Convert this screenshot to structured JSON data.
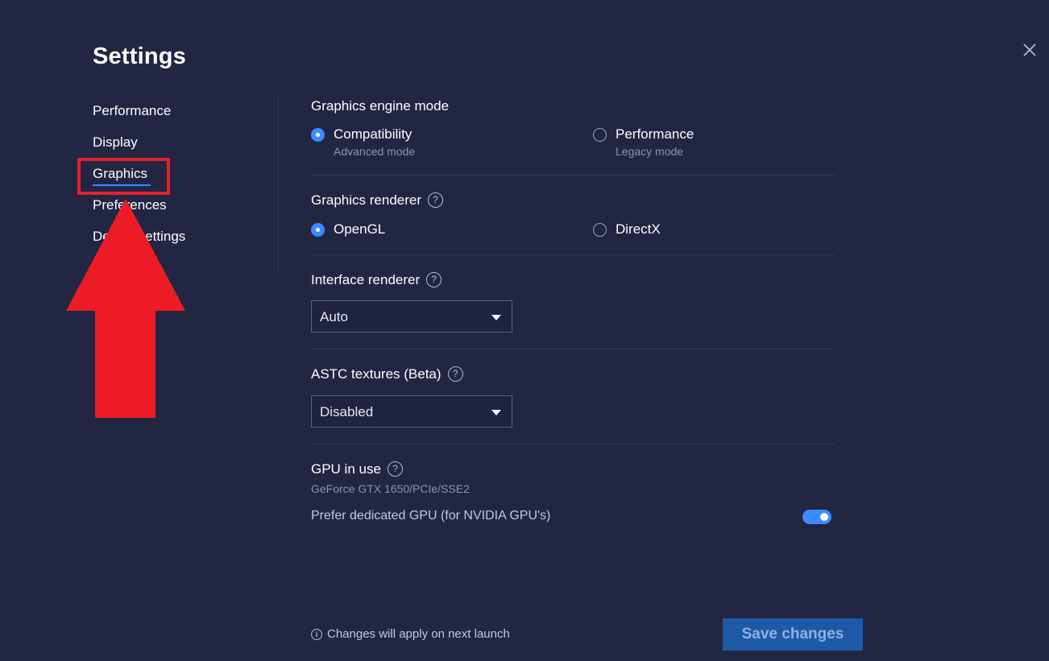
{
  "window": {
    "title": "Settings"
  },
  "nav": {
    "items": [
      {
        "label": "Performance",
        "active": false
      },
      {
        "label": "Display",
        "active": false
      },
      {
        "label": "Graphics",
        "active": true
      },
      {
        "label": "Preferences",
        "active": false
      },
      {
        "label": "Device settings",
        "active": false
      }
    ]
  },
  "graphics_engine": {
    "title": "Graphics engine mode",
    "options": [
      {
        "label": "Compatibility",
        "sub": "Advanced mode",
        "selected": true
      },
      {
        "label": "Performance",
        "sub": "Legacy mode",
        "selected": false
      }
    ]
  },
  "graphics_renderer": {
    "title": "Graphics renderer",
    "options": [
      {
        "label": "OpenGL",
        "selected": true
      },
      {
        "label": "DirectX",
        "selected": false
      }
    ]
  },
  "interface_renderer": {
    "title": "Interface renderer",
    "value": "Auto"
  },
  "astc": {
    "title": "ASTC textures (Beta)",
    "value": "Disabled"
  },
  "gpu": {
    "title": "GPU in use",
    "name": "GeForce GTX 1650/PCIe/SSE2",
    "prefer_label": "Prefer dedicated GPU (for NVIDIA GPU's)",
    "prefer_enabled": true
  },
  "footer": {
    "note": "Changes will apply on next launch",
    "save_label": "Save changes"
  },
  "colors": {
    "background": "#222643",
    "accent": "#3d8bff",
    "annotation": "#e5202b",
    "save_button": "#1e5aa8"
  }
}
